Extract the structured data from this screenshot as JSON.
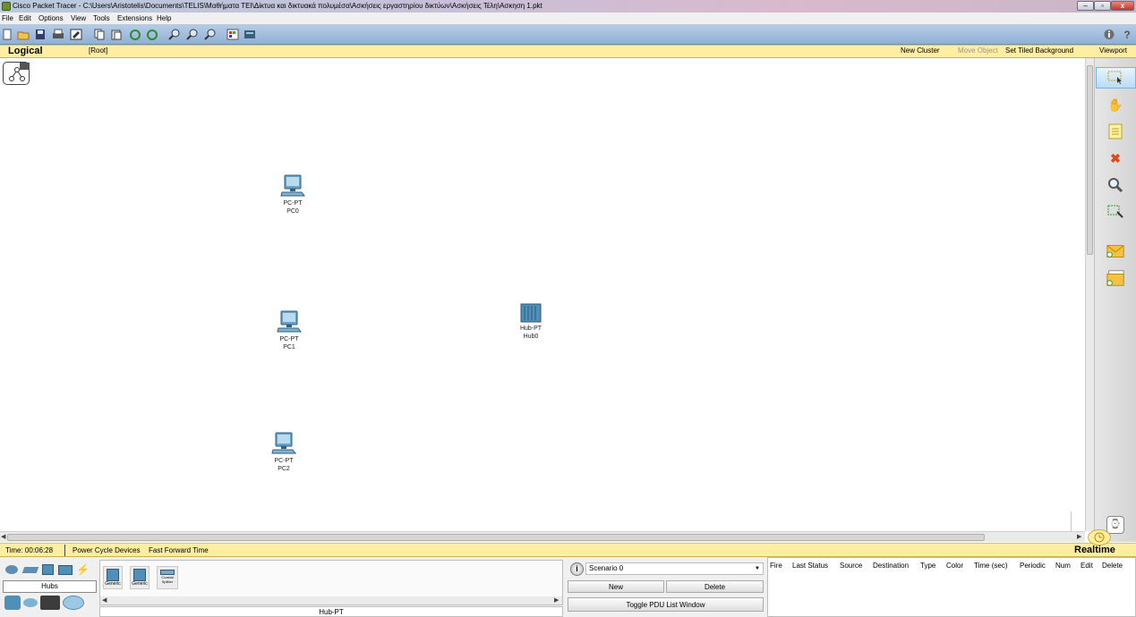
{
  "window": {
    "title": "Cisco Packet Tracer - C:\\Users\\Aristotelis\\Documents\\TELIS\\Μαθήματα ΤΕΙ\\Δίκτυα και δικτυακά πολυμέσα\\Ασκήσεις εργαστηρίου δικτύων\\Ασκήσεις Τέλη\\Ασκηση 1.pkt",
    "min_label": "–",
    "max_label": "▫",
    "close_label": "x"
  },
  "menu": [
    "File",
    "Edit",
    "Options",
    "View",
    "Tools",
    "Extensions",
    "Help"
  ],
  "logical_bar": {
    "mode": "Logical",
    "root": "[Root]",
    "new_cluster": "New Cluster",
    "move_object": "Move Object",
    "set_tiled_background": "Set Tiled Background",
    "viewport": "Viewport"
  },
  "devices": [
    {
      "type": "PC-PT",
      "name": "PC0"
    },
    {
      "type": "PC-PT",
      "name": "PC1"
    },
    {
      "type": "PC-PT",
      "name": "PC2"
    },
    {
      "type": "Hub-PT",
      "name": "Hub0"
    }
  ],
  "status": {
    "time": "Time: 00:06:28",
    "power_cycle": "Power Cycle Devices",
    "fast_forward": "Fast Forward Time",
    "mode": "Realtime"
  },
  "device_panel": {
    "category": "Hubs",
    "selected_model": "Hub-PT",
    "models": [
      "Generic",
      "Generic",
      "Coaxial Splitter"
    ]
  },
  "scenario": {
    "selected": "Scenario 0",
    "new_label": "New",
    "delete_label": "Delete",
    "toggle_label": "Toggle PDU List Window"
  },
  "pdu_columns": [
    "Fire",
    "Last Status",
    "Source",
    "Destination",
    "Type",
    "Color",
    "Time (sec)",
    "Periodic",
    "Num",
    "Edit",
    "Delete"
  ],
  "colors": {
    "toolbar": "#9fbde0",
    "yellow_bar": "#fdeea1",
    "device_blue": "#3c7fb0"
  }
}
